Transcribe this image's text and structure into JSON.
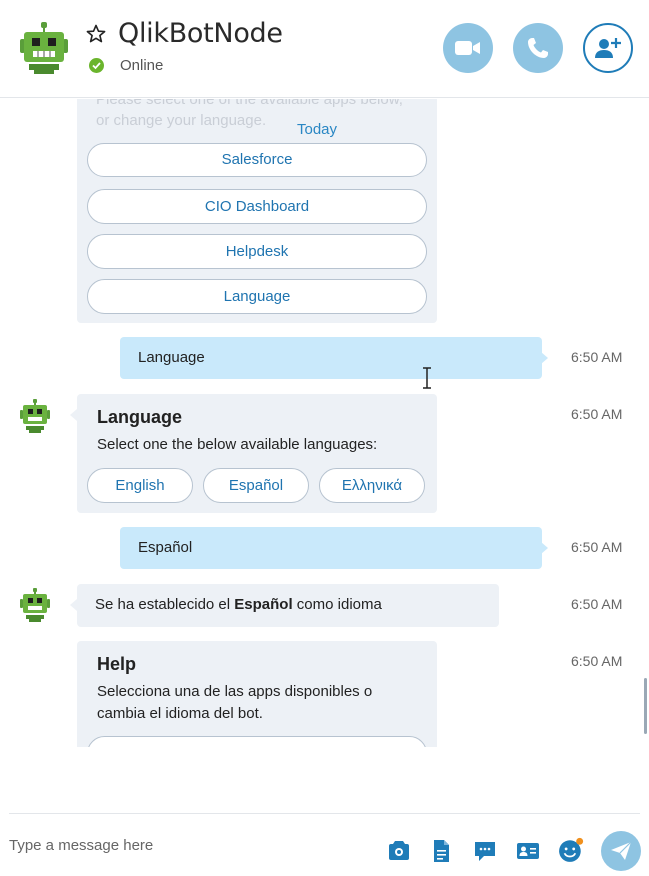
{
  "header": {
    "title": "QlikBotNode",
    "status": "Online"
  },
  "chat": {
    "faded_line_1": "Please select one of the available apps below,",
    "faded_line_2": "or change your language.",
    "today": "Today",
    "app_buttons": [
      "Salesforce",
      "CIO Dashboard",
      "Helpdesk",
      "Language"
    ],
    "msg_out_1": {
      "text": "Language",
      "time": "6:50 AM"
    },
    "language_card": {
      "title": "Language",
      "text": "Select one the below available languages:",
      "time": "6:50 AM",
      "options": [
        "English",
        "Español",
        "Ελληνικά"
      ]
    },
    "msg_out_2": {
      "text": "Español",
      "time": "6:50 AM"
    },
    "msg_in_1": {
      "prefix": "Se ha establecido el ",
      "bold": "Español",
      "suffix": " como idioma",
      "time": "6:50 AM"
    },
    "help_card": {
      "title": "Help",
      "line1": "Selecciona una de las apps disponibles o",
      "line2": "cambia el idioma del bot.",
      "time": "6:50 AM"
    }
  },
  "composer": {
    "placeholder": "Type a message here"
  },
  "colors": {
    "accent": "#1f7cb8",
    "outgoing_bubble": "#c9e9fb",
    "incoming_card": "#edf1f6",
    "online": "#6bb52d",
    "bot_green": "#5a9e3a"
  },
  "icons": [
    "bot-avatar-icon",
    "star-icon",
    "video-icon",
    "phone-icon",
    "add-person-icon",
    "media-icon",
    "file-icon",
    "chat-bubble-icon",
    "contact-card-icon",
    "emoji-icon",
    "send-icon"
  ]
}
